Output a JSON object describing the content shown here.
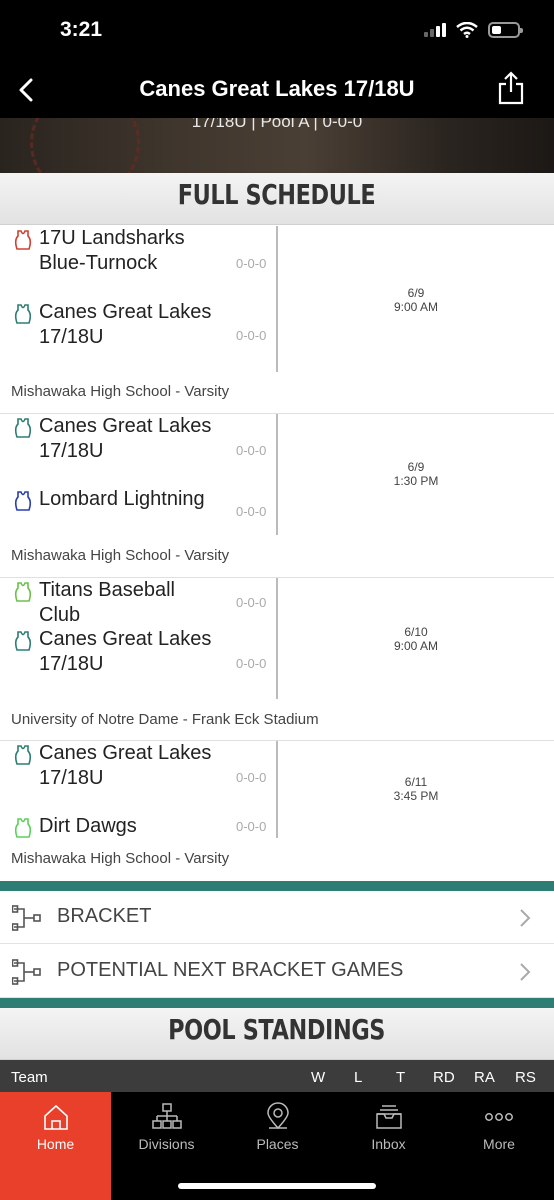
{
  "status": {
    "time": "3:21"
  },
  "nav": {
    "title": "Canes Great Lakes 17/18U"
  },
  "header": {
    "subtitle": "17/18U | Pool A | 0-0-0"
  },
  "schedule": {
    "title": "FULL SCHEDULE",
    "games": [
      {
        "team1": {
          "name": "17U Landsharks Blue-Turnock",
          "record": "0-0-0",
          "color": "#d04030"
        },
        "team2": {
          "name": "Canes Great Lakes 17/18U",
          "record": "0-0-0",
          "color": "#2e7d74"
        },
        "date": "6/9",
        "time": "9:00 AM",
        "venue": "Mishawaka High School - Varsity"
      },
      {
        "team1": {
          "name": "Canes Great Lakes 17/18U",
          "record": "0-0-0",
          "color": "#2e7d74"
        },
        "team2": {
          "name": "Lombard Lightning",
          "record": "0-0-0",
          "color": "#2a3fb0"
        },
        "date": "6/9",
        "time": "1:30 PM",
        "venue": "Mishawaka High School - Varsity"
      },
      {
        "team1": {
          "name": "Titans Baseball Club",
          "record": "0-0-0",
          "color": "#6cc04a"
        },
        "team2": {
          "name": "Canes Great Lakes 17/18U",
          "record": "0-0-0",
          "color": "#2e7d74"
        },
        "date": "6/10",
        "time": "9:00 AM",
        "venue": "University of Notre Dame - Frank Eck Stadium"
      },
      {
        "team1": {
          "name": "Canes Great Lakes 17/18U",
          "record": "0-0-0",
          "color": "#2e7d74"
        },
        "team2": {
          "name": "Dirt Dawgs",
          "record": "0-0-0",
          "color": "#5bd05a"
        },
        "date": "6/11",
        "time": "3:45 PM",
        "venue": "Mishawaka High School - Varsity"
      }
    ]
  },
  "links": {
    "bracket": "BRACKET",
    "potential": "POTENTIAL NEXT BRACKET GAMES"
  },
  "standings": {
    "title": "POOL STANDINGS",
    "columns": {
      "team": "Team",
      "w": "W",
      "l": "L",
      "t": "T",
      "rd": "RD",
      "ra": "RA",
      "rs": "RS"
    }
  },
  "tabs": [
    {
      "label": "Home",
      "icon": "home-icon"
    },
    {
      "label": "Divisions",
      "icon": "divisions-icon"
    },
    {
      "label": "Places",
      "icon": "map-pin-icon"
    },
    {
      "label": "Inbox",
      "icon": "inbox-icon"
    },
    {
      "label": "More",
      "icon": "more-icon"
    }
  ],
  "colors": {
    "accent": "#e8402a",
    "teal": "#2e7d74",
    "nav": "#000000"
  }
}
